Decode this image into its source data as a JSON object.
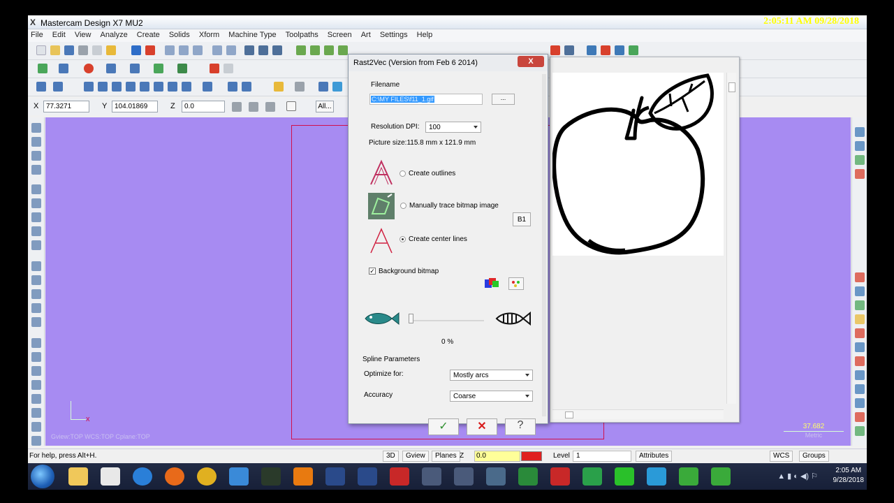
{
  "recording_clock": "2:05:11 AM 09/28/2018",
  "window": {
    "title": "Mastercam Design X7 MU2"
  },
  "menu": [
    "File",
    "Edit",
    "View",
    "Analyze",
    "Create",
    "Solids",
    "Xform",
    "Machine Type",
    "Toolpaths",
    "Screen",
    "Art",
    "Settings",
    "Help"
  ],
  "coords": {
    "x_label": "X",
    "x_value": "77.3271",
    "y_label": "Y",
    "y_value": "104.01869",
    "z_label": "Z",
    "z_value": "0.0",
    "all_label": "All..."
  },
  "viewport": {
    "view_info": "Gview:TOP   WCS:TOP   Cplane:TOP",
    "axis_x_label": "x",
    "scale_value": "37.682",
    "scale_unit": "Metric"
  },
  "dialog": {
    "title": "Rast2Vec (Version from Feb  6 2014)",
    "close_label": "X",
    "filename_label": "Filename",
    "filename_value": "C:\\MY FILES\\f11_1.gif",
    "browse_label": "...",
    "resolution_label": "Resolution DPI:",
    "resolution_value": "100",
    "picture_size": "Picture size:115.8 mm x 121.9 mm",
    "opt_outlines": "Create outlines",
    "opt_trace": "Manually trace bitmap image",
    "trace_button": "B1",
    "opt_centerlines": "Create center lines",
    "background_bitmap_label": "Background bitmap",
    "background_bitmap_checked": true,
    "slider_percent": "0 %",
    "spline_params_label": "Spline Parameters",
    "optimize_label": "Optimize for:",
    "optimize_value": "Mostly arcs",
    "accuracy_label": "Accuracy",
    "accuracy_value": "Coarse",
    "ok_icon": "checkmark-icon",
    "cancel_icon": "red-x-icon",
    "help_icon": "question-icon"
  },
  "status": {
    "help_text": "For help, press Alt+H.",
    "btn_3d": "3D",
    "btn_gview": "Gview",
    "btn_planes": "Planes",
    "z_label": "Z",
    "z_value": "0.0",
    "level_label": "Level",
    "level_value": "1",
    "attributes_label": "Attributes",
    "wcs_label": "WCS",
    "groups_label": "Groups"
  },
  "taskbar": {
    "time": "2:05 AM",
    "date": "9/28/2018"
  },
  "colors": {
    "canvas": "#a78bf2",
    "accent_red": "#d0104c",
    "dialog_bg": "#f0f0f0"
  }
}
